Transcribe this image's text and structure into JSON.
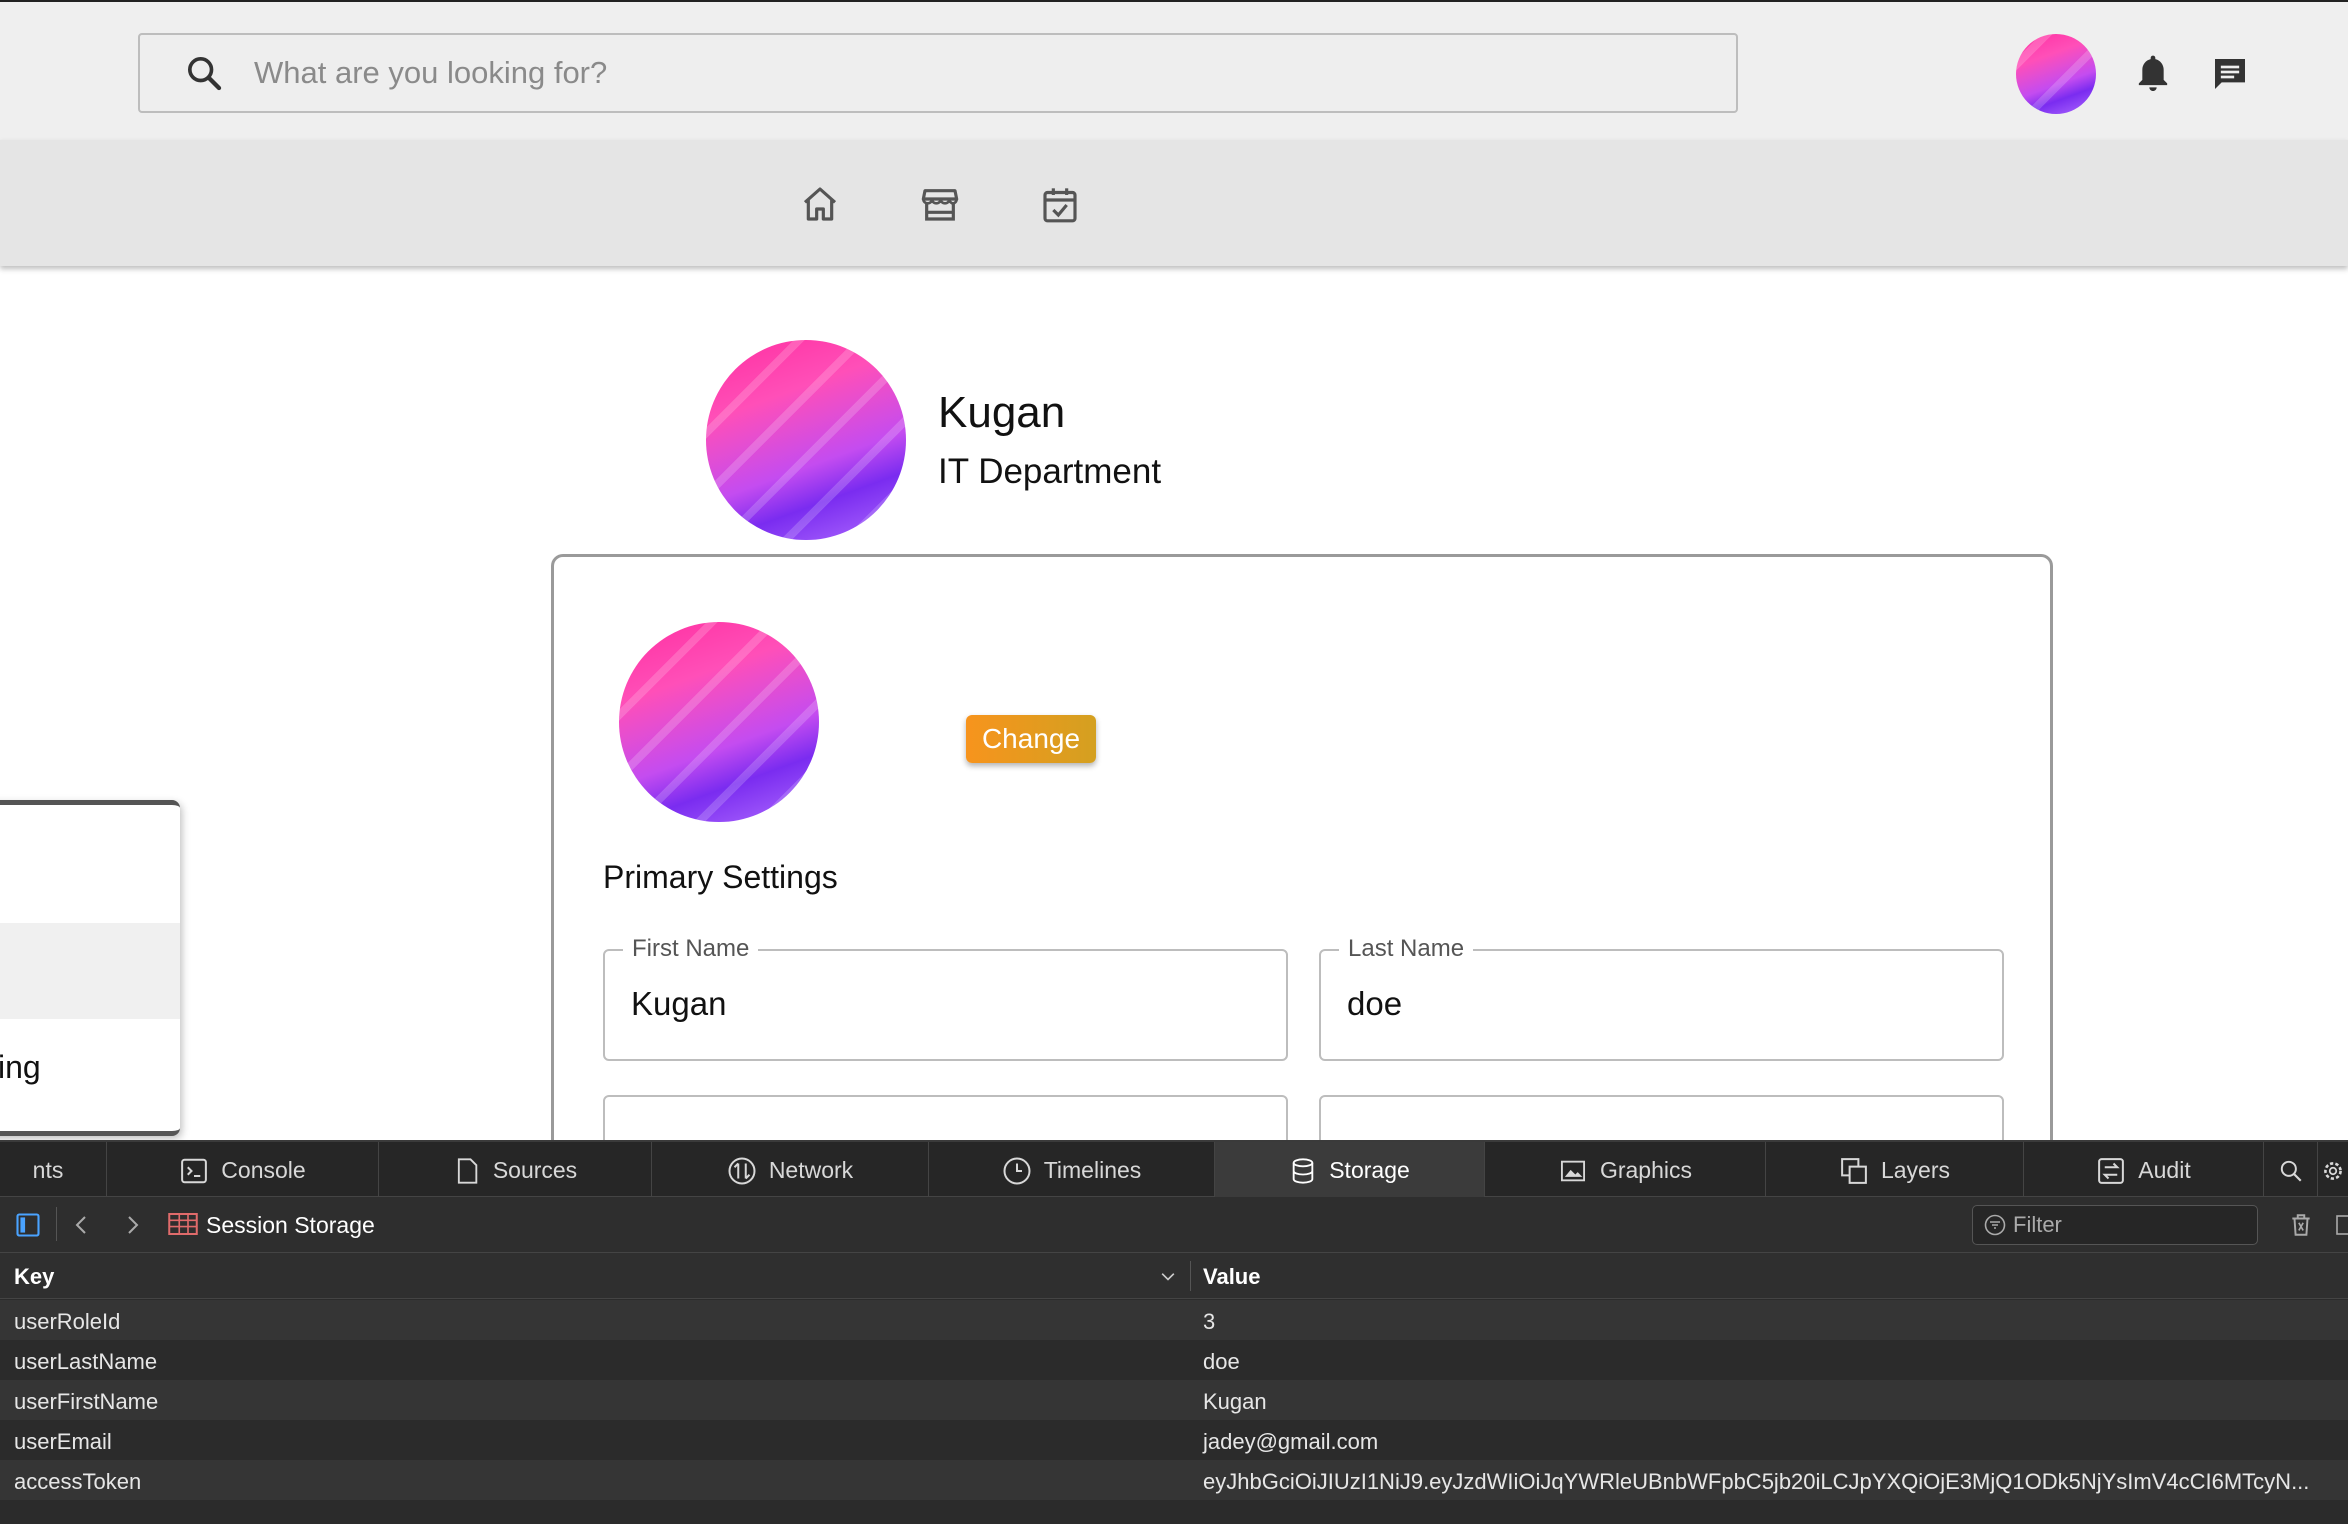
{
  "search": {
    "placeholder": "What are you looking for?"
  },
  "header_icons": [
    "user-avatar",
    "bell-icon",
    "chat-icon"
  ],
  "nav": {
    "icons": [
      "home-icon",
      "store-icon",
      "calendar-check-icon"
    ]
  },
  "profile": {
    "name": "Kugan",
    "department": "IT Department"
  },
  "card": {
    "change_label": "Change",
    "section_title": "Primary Settings",
    "fields": [
      {
        "label": "First Name",
        "value": "Kugan"
      },
      {
        "label": "Last Name",
        "value": "doe"
      }
    ]
  },
  "popup": {
    "items": [
      "",
      "",
      "ing"
    ]
  },
  "devtools": {
    "tabs": [
      "nts",
      "Console",
      "Sources",
      "Network",
      "Timelines",
      "Storage",
      "Graphics",
      "Layers",
      "Audit"
    ],
    "active_tab": "Storage",
    "breadcrumb": "Session Storage",
    "filter_placeholder": "Filter",
    "columns": [
      "Key",
      "Value"
    ],
    "rows": [
      {
        "key": "userRoleId",
        "value": "3"
      },
      {
        "key": "userLastName",
        "value": "doe"
      },
      {
        "key": "userFirstName",
        "value": "Kugan"
      },
      {
        "key": "userEmail",
        "value": "jadey@gmail.com"
      },
      {
        "key": "accessToken",
        "value": "eyJhbGciOiJIUzI1NiJ9.eyJzdWIiOiJqYWRleUBnbWFpbC5jb20iLCJpYXQiOjE3MjQ1ODk5NjYsImV4cCI6MTcyN..."
      }
    ]
  },
  "colors": {
    "accent_orange": "#f7941d",
    "avatar_pink": "#ff2fa0",
    "avatar_purple": "#7a2cf0",
    "devtools_bg": "#2b2b2b"
  }
}
